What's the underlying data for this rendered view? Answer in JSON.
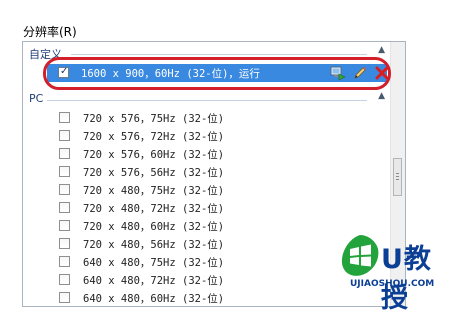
{
  "resolution_label": "分辨率(R)",
  "groups": {
    "custom": {
      "label": "自定义"
    },
    "pc": {
      "label": "PC"
    }
  },
  "selected_mode": {
    "label": "1600 x 900，60Hz (32-位)，运行",
    "checked": true
  },
  "modes": [
    {
      "label": "720 x 576，75Hz (32-位)"
    },
    {
      "label": "720 x 576，72Hz (32-位)"
    },
    {
      "label": "720 x 576，60Hz (32-位)"
    },
    {
      "label": "720 x 576，56Hz (32-位)"
    },
    {
      "label": "720 x 480，75Hz (32-位)"
    },
    {
      "label": "720 x 480，72Hz (32-位)"
    },
    {
      "label": "720 x 480，60Hz (32-位)"
    },
    {
      "label": "720 x 480，56Hz (32-位)"
    },
    {
      "label": "640 x 480，75Hz (32-位)"
    },
    {
      "label": "640 x 480，72Hz (32-位)"
    },
    {
      "label": "640 x 480，60Hz (32-位)"
    }
  ],
  "icons": {
    "apply": "apply-display-icon",
    "edit": "pencil-icon",
    "delete": "close-x-icon",
    "collapse": "chevron-up-icon"
  },
  "colors": {
    "selection": "#3a89e0",
    "annotation": "#d21f2a",
    "group_text": "#1f3f76"
  },
  "watermark": {
    "brand": "U教授",
    "url": "UJIAOSHOU.COM"
  }
}
